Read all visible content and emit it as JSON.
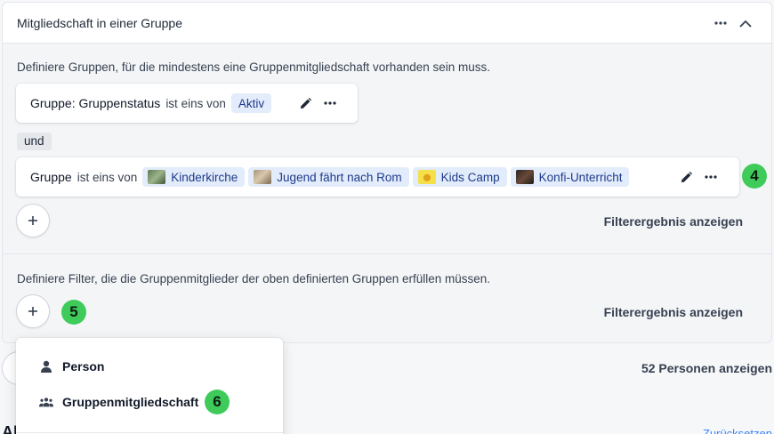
{
  "card": {
    "title": "Mitgliedschaft in einer Gruppe",
    "more_icon": "ellipsis-icon",
    "collapse_icon": "chevron-up-icon"
  },
  "groups_section": {
    "description": "Definiere Gruppen, für die mindestens eine Gruppenmitgliedschaft vorhanden sein muss.",
    "filter1": {
      "field": "Gruppe: Gruppenstatus",
      "operator": "ist eins von",
      "values": [
        "Aktiv"
      ]
    },
    "connector": "und",
    "filter2": {
      "field": "Gruppe",
      "operator": "ist eins von",
      "values": [
        "Kinderkirche",
        "Jugend fährt nach Rom",
        "Kids Camp",
        "Konfi-Unterricht"
      ]
    },
    "show_result_label": "Filterergebnis anzeigen",
    "badge": "4"
  },
  "members_section": {
    "description": "Definiere Filter, die die Gruppenmitglieder der oben definierten Gruppen erfüllen müssen.",
    "show_result_label": "Filterergebnis anzeigen",
    "badge": "5"
  },
  "dropdown": {
    "items": [
      {
        "label": "Person",
        "icon": "person-icon"
      },
      {
        "label": "Gruppenmitgliedschaft",
        "icon": "people-group-icon"
      }
    ],
    "badge": "6"
  },
  "footer": {
    "count_label": "52 Personen anzeigen",
    "cut_heading": "Al",
    "reset_label": "Zurücksetzen"
  },
  "colors": {
    "chip_bg": "#e3ecfb",
    "chip_text": "#1e3a8a",
    "badge_green": "#3ecb5a",
    "link_blue": "#3b82f6"
  }
}
